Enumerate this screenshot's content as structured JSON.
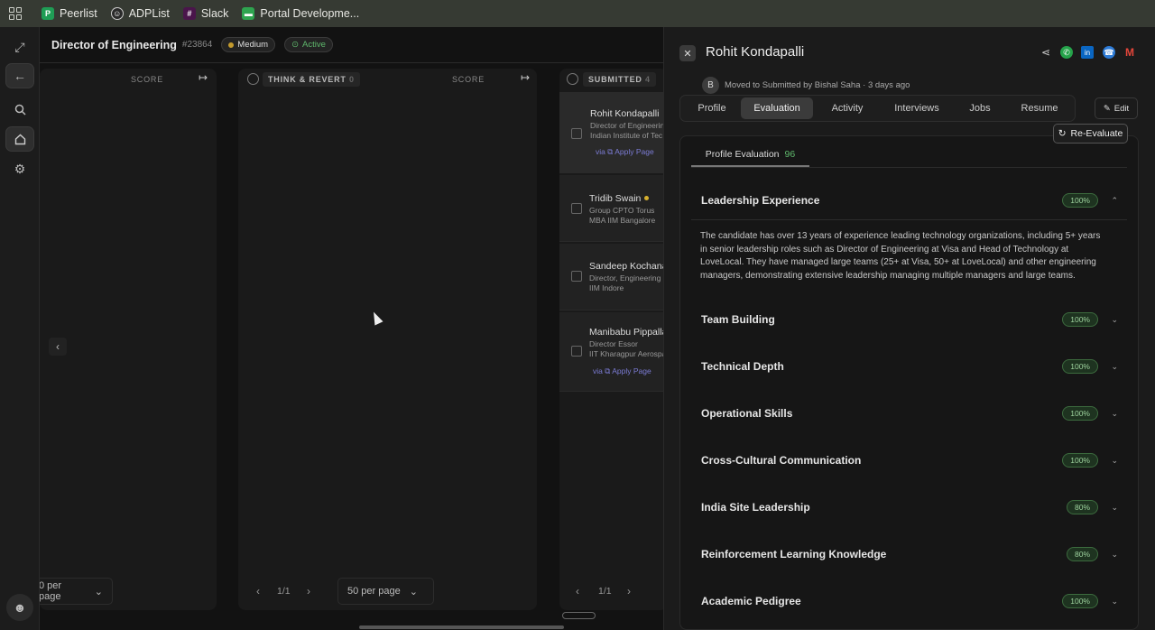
{
  "bookmarks": [
    {
      "label": "Peerlist",
      "letter": "P",
      "color": "#1f9d55"
    },
    {
      "label": "ADPList",
      "letter": "☺",
      "color": "#2a2a2a"
    },
    {
      "label": "Slack",
      "letter": "#",
      "color": "#4a154b"
    },
    {
      "label": "Portal Developme...",
      "letter": "▬",
      "color": "#2ea44f"
    }
  ],
  "header": {
    "job_title": "Director of Engineering",
    "job_id": "#23864",
    "priority": "Medium",
    "status": "Active"
  },
  "columns": {
    "left": {
      "score_label": "SCORE",
      "per_page": "0 per page"
    },
    "think": {
      "title": "THINK & REVERT",
      "count": "0",
      "score_label": "SCORE",
      "page": "1/1",
      "per_page": "50 per page"
    },
    "submitted": {
      "title": "SUBMITTED",
      "count": "4",
      "page": "1/1"
    }
  },
  "candidates": [
    {
      "name": "Rohit Kondapalli",
      "line1": "Director of Engineerin",
      "line2": "Indian Institute of Tec",
      "via": "via",
      "via_link": "Apply Page"
    },
    {
      "name": "Tridib Swain",
      "line1": "Group CPTO Torus",
      "line2": "MBA IIM Bangalore"
    },
    {
      "name": "Sandeep Kochana",
      "line1": "Director, Engineering",
      "line2": "IIM Indore"
    },
    {
      "name": "Manibabu Pippalla",
      "line1": "Director Essor",
      "line2": "IIT Kharagpur Aerospa",
      "via": "via",
      "via_link": "Apply Page"
    }
  ],
  "panel": {
    "name": "Rohit Kondapalli",
    "avatar_letter": "B",
    "moved_text": "Moved to Submitted by Bishal Saha · 3 days ago",
    "tabs": [
      "Profile",
      "Evaluation",
      "Activity",
      "Interviews",
      "Jobs",
      "Resume"
    ],
    "active_tab": "Evaluation",
    "edit_label": "Edit",
    "reevaluate_label": "Re-Evaluate",
    "eval_tab_label": "Profile Evaluation",
    "eval_score": "96",
    "sections": [
      {
        "title": "Leadership Experience",
        "pct": "100%",
        "expanded": true
      },
      {
        "title": "Team Building",
        "pct": "100%"
      },
      {
        "title": "Technical Depth",
        "pct": "100%"
      },
      {
        "title": "Operational Skills",
        "pct": "100%"
      },
      {
        "title": "Cross-Cultural Communication",
        "pct": "100%"
      },
      {
        "title": "India Site Leadership",
        "pct": "80%"
      },
      {
        "title": "Reinforcement Learning Knowledge",
        "pct": "80%"
      },
      {
        "title": "Academic Pedigree",
        "pct": "100%"
      }
    ],
    "leadership_description": "The candidate has over 13 years of experience leading technology organizations, including 5+ years in senior leadership roles such as Director of Engineering at Visa and Head of Technology at LoveLocal. They have managed large teams (25+ at Visa, 50+ at LoveLocal) and other engineering managers, demonstrating extensive leadership managing multiple managers and large teams."
  }
}
